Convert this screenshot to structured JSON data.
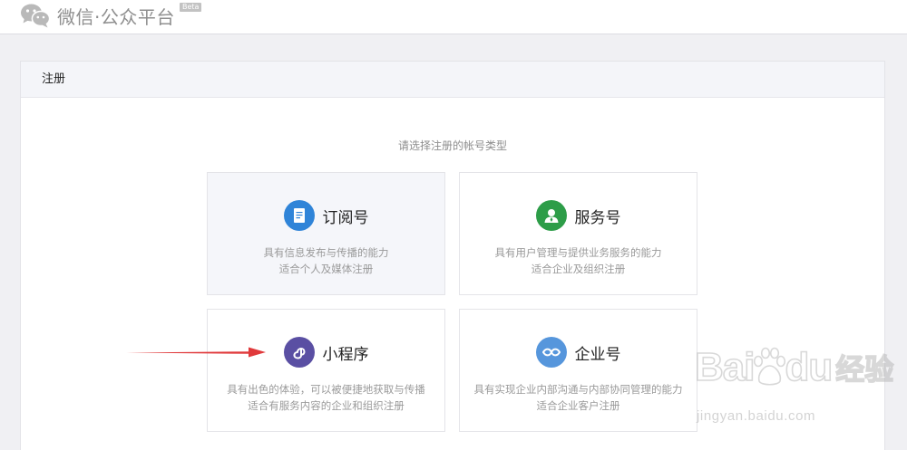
{
  "header": {
    "logo_text": "微信·公众平台",
    "beta_label": "Beta"
  },
  "panel": {
    "title": "注册",
    "subtitle": "请选择注册的帐号类型"
  },
  "cards": [
    {
      "title": "订阅号",
      "desc_line1": "具有信息发布与传播的能力",
      "desc_line2": "适合个人及媒体注册",
      "icon": "document-icon",
      "color": "#2f84d8"
    },
    {
      "title": "服务号",
      "desc_line1": "具有用户管理与提供业务服务的能力",
      "desc_line2": "适合企业及组织注册",
      "icon": "user-icon",
      "color": "#2d9d48"
    },
    {
      "title": "小程序",
      "desc_line1": "具有出色的体验，可以被便捷地获取与传播",
      "desc_line2": "适合有服务内容的企业和组织注册",
      "icon": "mini-program-icon",
      "color": "#5a4fa3"
    },
    {
      "title": "企业号",
      "desc_line1": "具有实现企业内部沟通与内部协同管理的能力",
      "desc_line2": "适合企业客户注册",
      "icon": "enterprise-icon",
      "color": "#5696dc"
    }
  ],
  "annotation": {
    "arrow_color": "#e0393b",
    "arrow_target": "小程序"
  },
  "watermark": {
    "brand_left": "Bai",
    "brand_right": "du",
    "brand_cn": "经验",
    "url": "jingyan.baidu.com"
  }
}
